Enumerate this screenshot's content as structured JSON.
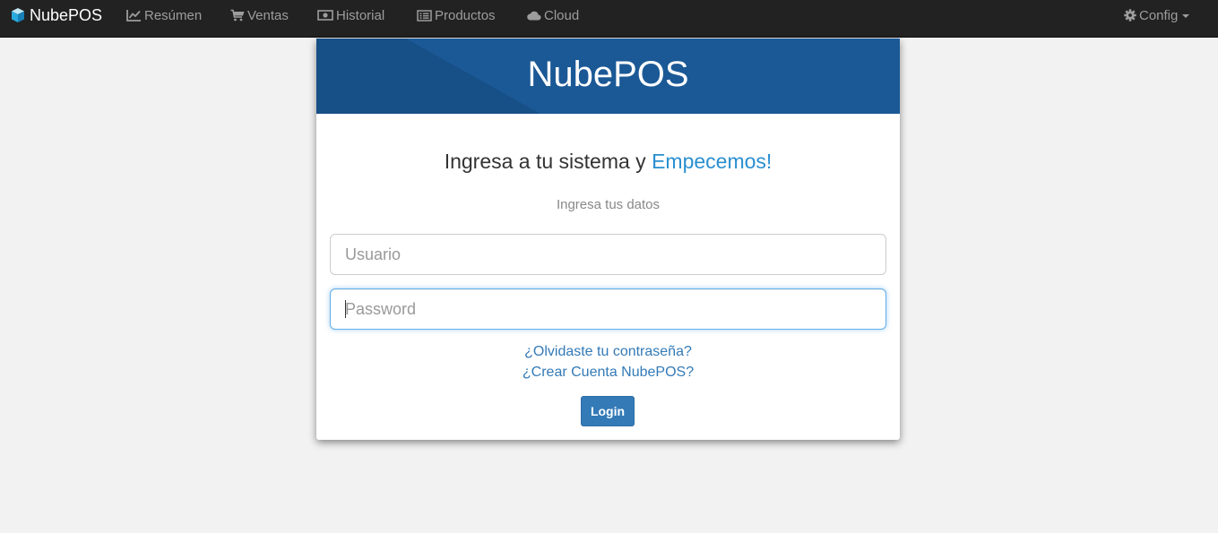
{
  "navbar": {
    "brand": "NubePOS",
    "items": [
      {
        "label": "Resúmen",
        "icon": "line-chart-icon"
      },
      {
        "label": "Ventas",
        "icon": "shopping-cart-icon"
      },
      {
        "label": "Historial",
        "icon": "money-icon"
      },
      {
        "label": "Productos",
        "icon": "list-alt-icon"
      },
      {
        "label": "Cloud",
        "icon": "cloud-icon"
      }
    ],
    "config": {
      "label": "Config",
      "icon": "gear-icon"
    }
  },
  "card": {
    "title": "NubePOS",
    "headline_prefix": "Ingresa a tu sistema y ",
    "headline_accent": "Empecemos!",
    "subtitle": "Ingresa tus datos",
    "username_placeholder": "Usuario",
    "password_placeholder": "Password",
    "forgot_link": "¿Olvidaste tu contraseña?",
    "create_link": "¿Crear Cuenta NubePOS?",
    "login_button": "Login"
  },
  "colors": {
    "navbar_bg": "#222222",
    "nav_text": "#9d9d9d",
    "header_blue": "#1a5693",
    "accent": "#2a8fd0",
    "link": "#337ab7",
    "button": "#337ab7",
    "page_bg": "#f2f2f2"
  }
}
